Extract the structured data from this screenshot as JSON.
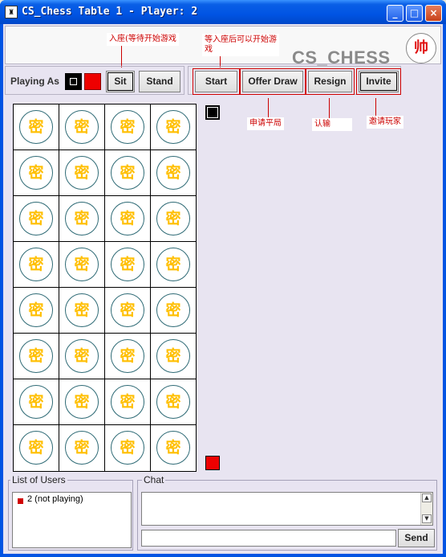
{
  "window": {
    "title": "CS_Chess Table 1 - Player: 2",
    "icon_glyph": "♜",
    "controls": {
      "minimize": "_",
      "maximize": "□",
      "close": "×"
    }
  },
  "branding": {
    "logo_text": "CS_CHESS",
    "seal_char": "帅"
  },
  "annotations": {
    "sit": "入座(等待开始游戏",
    "start": "等入座后可以开始游戏",
    "offer_draw": "申请平局",
    "resign": "认输",
    "invite": "邀请玩家"
  },
  "seat_panel": {
    "playing_as_label": "Playing As",
    "colors": {
      "black": "#000000",
      "red": "#ee0000"
    },
    "sit_label": "Sit",
    "stand_label": "Stand"
  },
  "actions": {
    "start_label": "Start",
    "offer_draw_label": "Offer Draw",
    "resign_label": "Resign",
    "invite_label": "Invite"
  },
  "board": {
    "columns": 4,
    "rows": 8,
    "piece_char": "密",
    "piece_color": "#ffbf00"
  },
  "turn_indicators": {
    "top": "black",
    "bottom": "red"
  },
  "users_panel": {
    "title": "List of Users",
    "users": [
      {
        "label": "2 (not playing)",
        "color": "#d00000"
      }
    ]
  },
  "chat_panel": {
    "title": "Chat",
    "input_value": "",
    "send_label": "Send"
  }
}
